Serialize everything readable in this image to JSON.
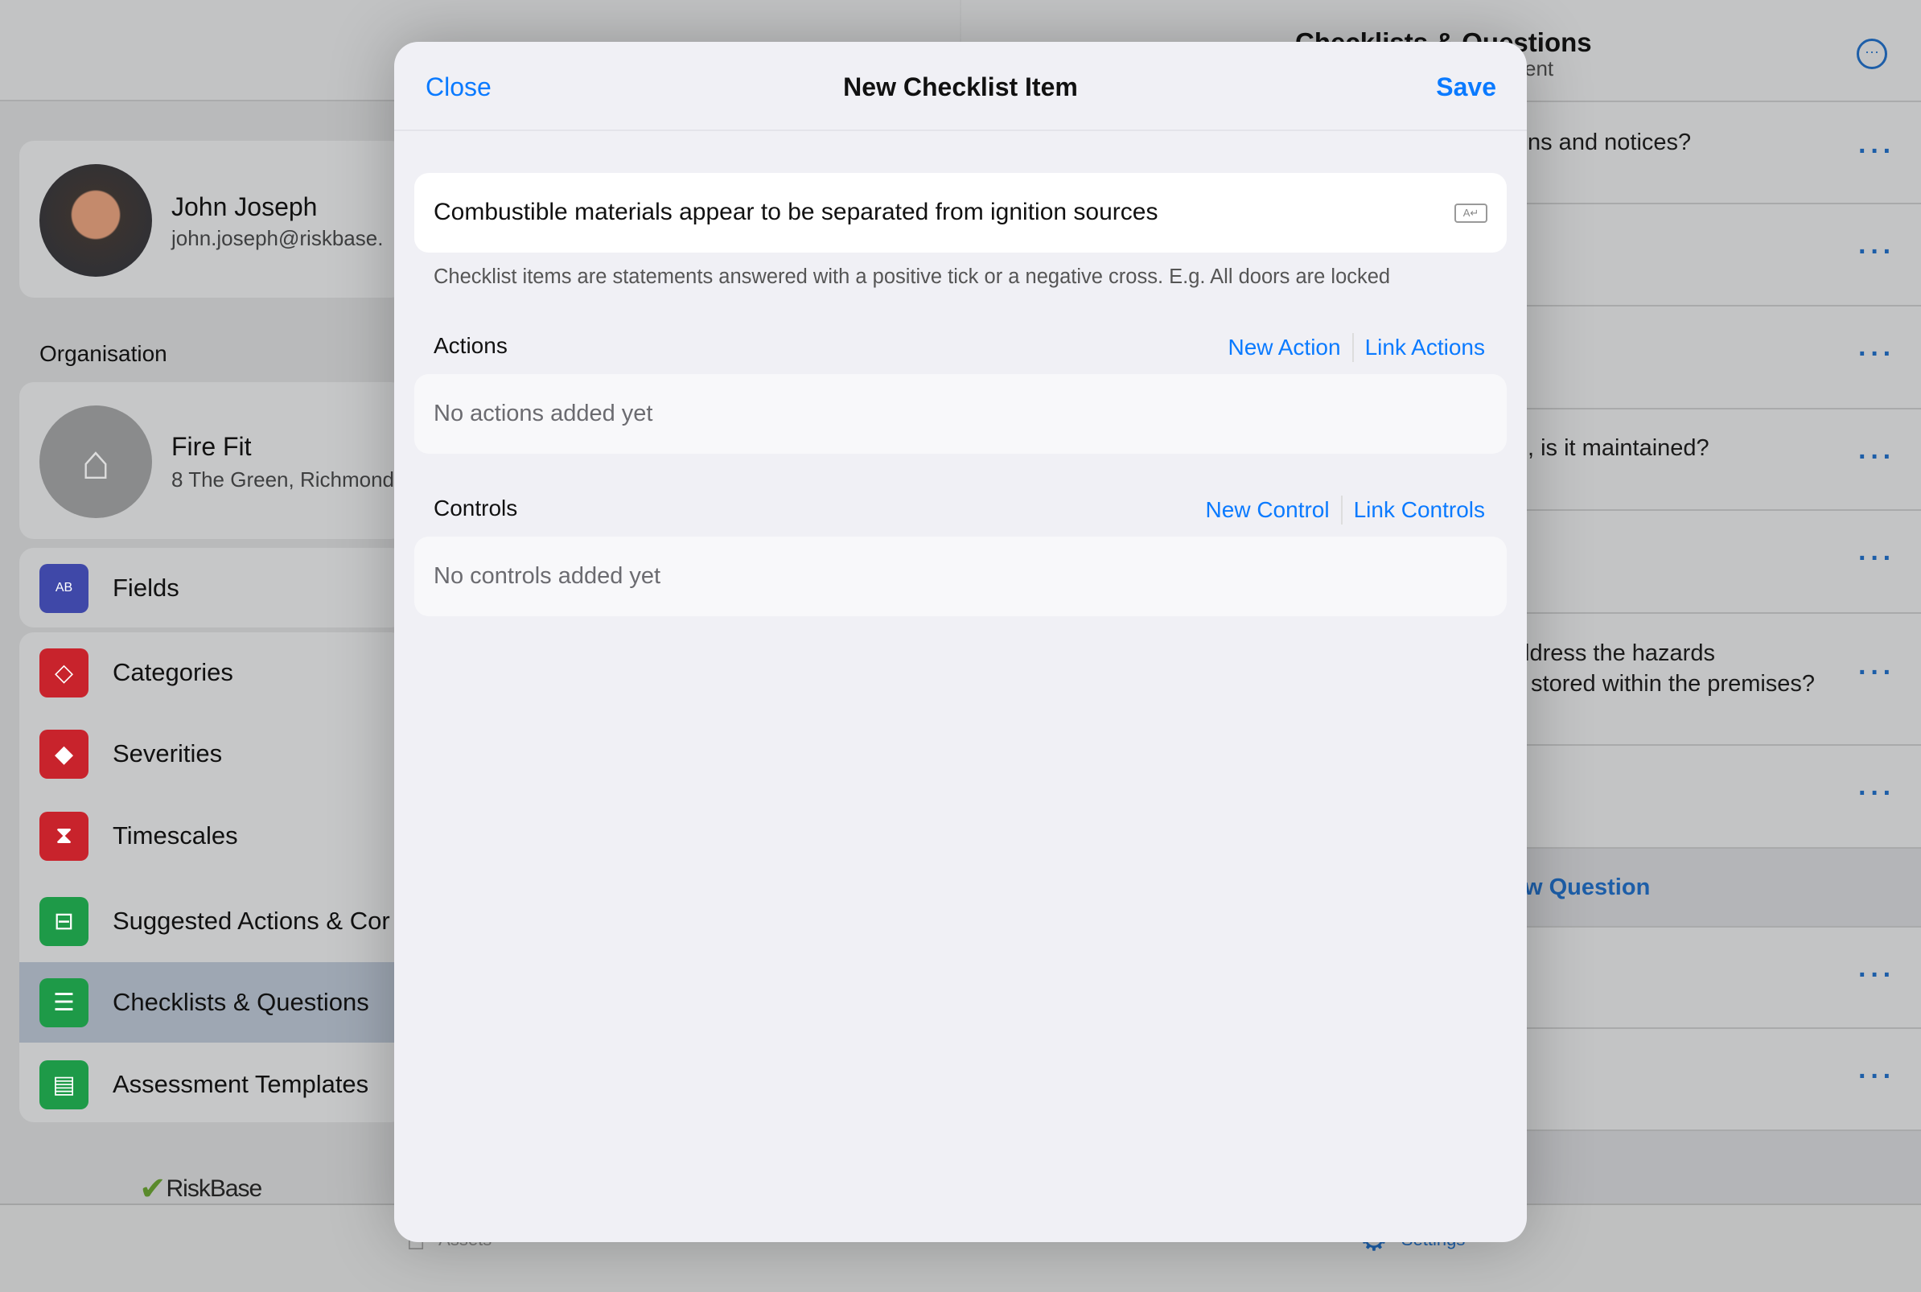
{
  "profile": {
    "name": "John Joseph",
    "email": "john.joseph@riskbase."
  },
  "organisation": {
    "heading": "Organisation",
    "name": "Fire Fit",
    "address": "8 The Green, Richmond"
  },
  "sidebar": {
    "items": [
      {
        "label": "Fields",
        "icon": "ab-field-icon",
        "color": "#3f48a8"
      },
      {
        "label": "Categories",
        "icon": "tag-icon",
        "color": "#c8232c"
      },
      {
        "label": "Severities",
        "icon": "warning-diamond-icon",
        "color": "#c8232c"
      },
      {
        "label": "Timescales",
        "icon": "hourglass-icon",
        "color": "#c8232c"
      },
      {
        "label": "Suggested Actions & Cor",
        "icon": "signpost-icon",
        "color": "#1e9a48"
      },
      {
        "label": "Checklists & Questions",
        "icon": "checklist-icon",
        "color": "#1e9a48",
        "selected": true
      },
      {
        "label": "Assessment Templates",
        "icon": "template-icon",
        "color": "#1e9a48"
      }
    ]
  },
  "logo": "RiskBase",
  "detail": {
    "title": "Checklists & Questions",
    "subtitle": "ent",
    "rows": [
      "ns and notices?",
      "",
      "",
      ", is it maintained?",
      "",
      "ldress the hazards\n stored within the premises?",
      ""
    ],
    "section_action": "w Question",
    "rows2": [
      "",
      ""
    ]
  },
  "tabbar": {
    "assets": "Assets",
    "settings": "Settings"
  },
  "modal": {
    "close": "Close",
    "title": "New Checklist Item",
    "save": "Save",
    "item_text": "Combustible materials appear to be separated from ignition sources",
    "hint": "Checklist items are statements answered with a positive tick or a negative cross. E.g. All doors are locked",
    "actions": {
      "heading": "Actions",
      "new": "New Action",
      "link": "Link Actions",
      "empty": "No actions added yet"
    },
    "controls": {
      "heading": "Controls",
      "new": "New Control",
      "link": "Link Controls",
      "empty": "No controls added yet"
    }
  },
  "colors": {
    "accent": "#0a7aff"
  }
}
